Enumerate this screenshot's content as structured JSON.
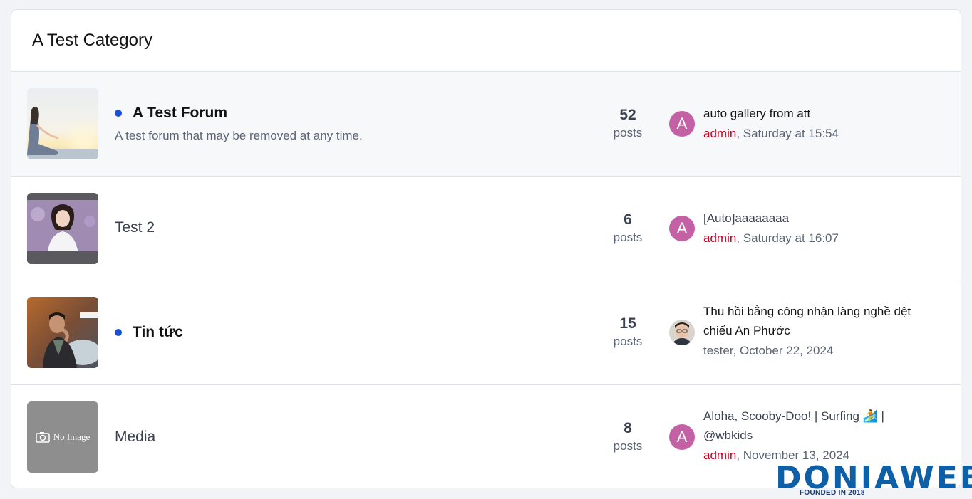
{
  "category": {
    "title": "A Test Category"
  },
  "forums": [
    {
      "title": "A Test Forum",
      "description": "A test forum that may be removed at any time.",
      "unread": true,
      "stat_value": "52",
      "stat_label": "posts",
      "latest_title": "auto gallery from att",
      "latest_user": "admin",
      "latest_time": ", Saturday at 15:54",
      "avatar_letter": "A"
    },
    {
      "title": "Test 2",
      "unread": false,
      "stat_value": "6",
      "stat_label": "posts",
      "latest_title": "[Auto]aaaaaaaa",
      "latest_user": "admin",
      "latest_time": ", Saturday at 16:07",
      "avatar_letter": "A"
    },
    {
      "title": "Tin tức",
      "unread": true,
      "stat_value": "15",
      "stat_label": "posts",
      "latest_title": "Thu hồi bằng công nhận làng nghề dệt chiếu An Phước",
      "latest_user": "tester",
      "latest_time": ", October 22, 2024"
    },
    {
      "title": "Media",
      "unread": false,
      "thumb_text": "No Image",
      "stat_value": "8",
      "stat_label": "posts",
      "latest_title": "Aloha, Scooby-Doo! | Surfing 🏄 | @wbkids",
      "latest_user": "admin",
      "latest_time": ", November 13, 2024",
      "avatar_letter": "A"
    }
  ],
  "watermark": {
    "brand": "DONIAWEB",
    "tagline": "FOUNDED IN 2018"
  },
  "colors": {
    "accent_dot": "#1a4fd6",
    "avatar": "#c461a4",
    "admin_user": "#c8001e"
  }
}
